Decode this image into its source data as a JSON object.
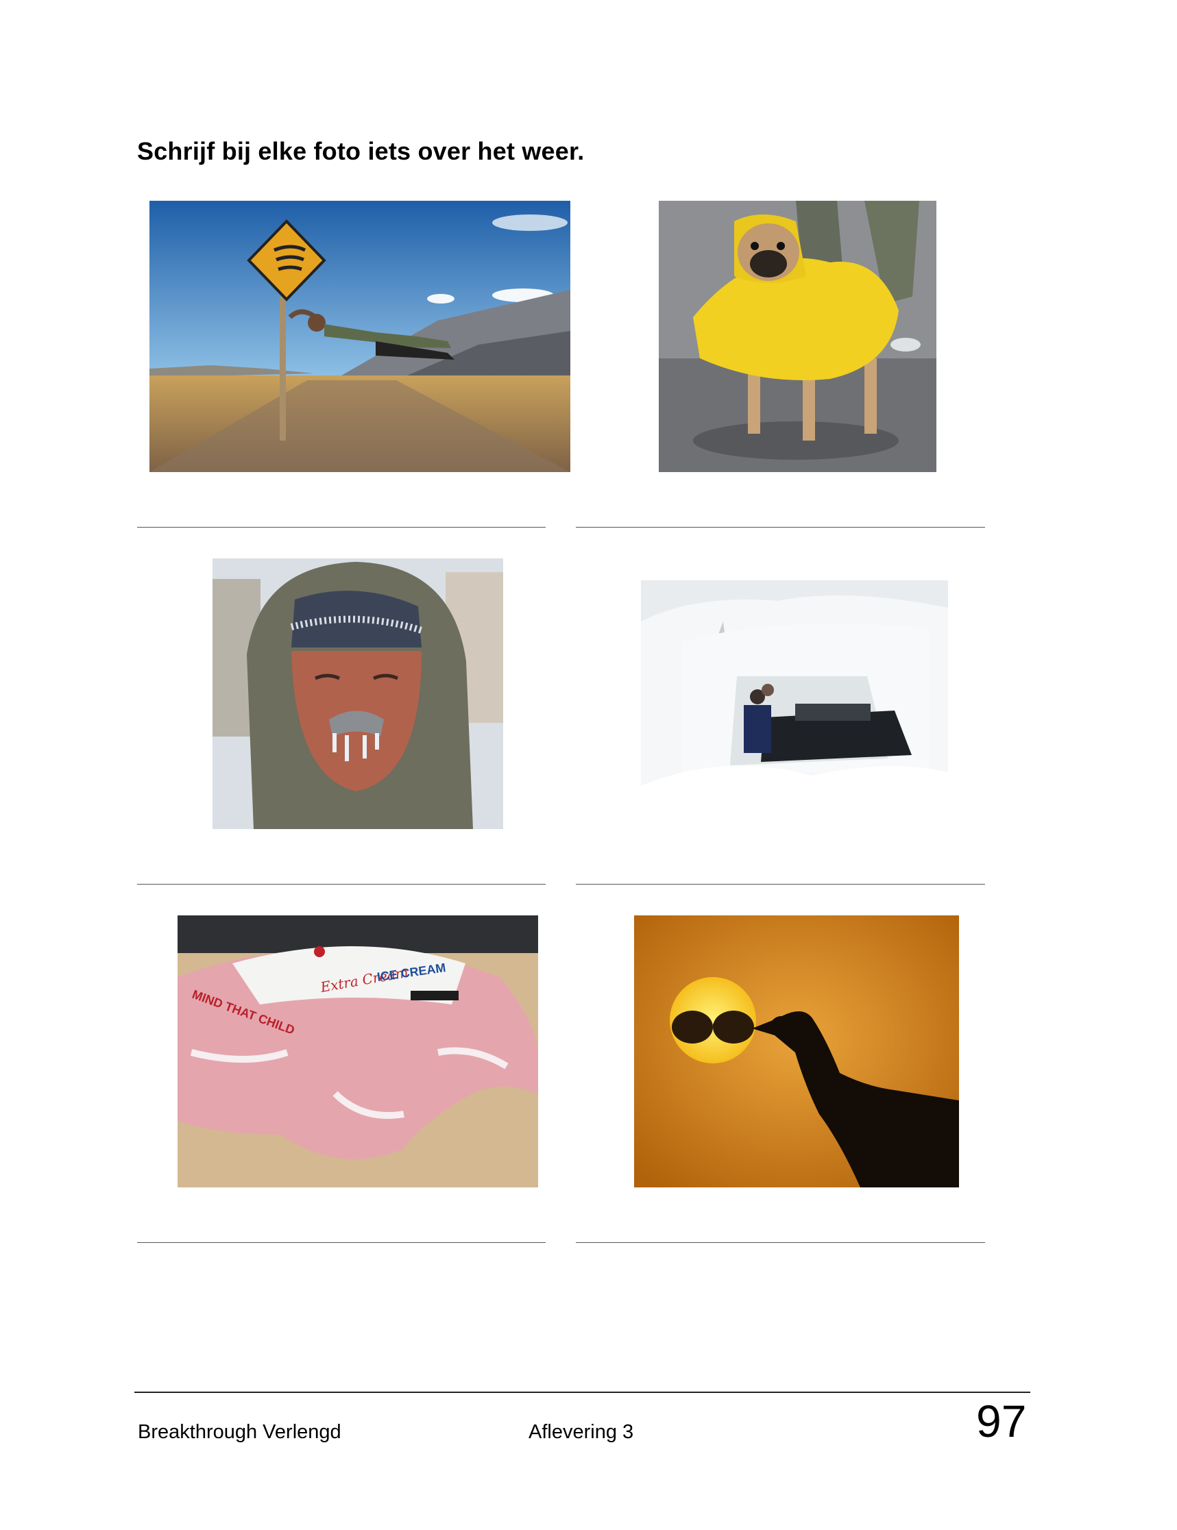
{
  "instruction": "Schrijf bij elke foto iets over het weer.",
  "photos": [
    {
      "name": "windy-road-sign-photo",
      "subject": "man blown horizontal holding a wind warning sign on a desert road"
    },
    {
      "name": "pug-raincoat-photo",
      "subject": "pug wearing a yellow raincoat on a wet street"
    },
    {
      "name": "frozen-man-photo",
      "subject": "man in a hood with icicles frozen in his moustache"
    },
    {
      "name": "snowed-in-car-photo",
      "subject": "two people and a car buried in deep snow"
    },
    {
      "name": "melting-ice-cream-van-photo",
      "subject": "ice cream van melting into the sand"
    },
    {
      "name": "sun-sunglasses-photo",
      "subject": "hand holding sunglasses in front of the sun"
    }
  ],
  "van_text": {
    "brand": "Extra Cream",
    "product": "ICE CREAM",
    "side": "MIND THAT CHILD"
  },
  "footer": {
    "series": "Breakthrough Verlengd",
    "episode": "Aflevering 3",
    "page_number": "97"
  },
  "colors": {
    "rule": "#555555",
    "footer_rule": "#222222",
    "text": "#000000"
  }
}
